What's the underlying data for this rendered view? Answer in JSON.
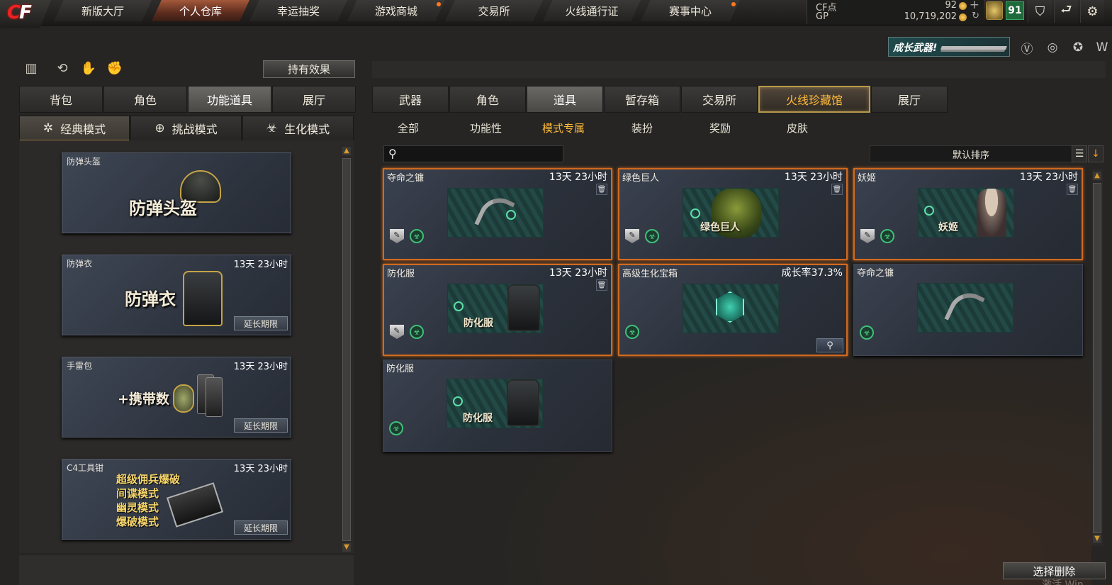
{
  "topnav": {
    "tabs": [
      "新版大厅",
      "个人仓库",
      "幸运抽奖",
      "游戏商城",
      "交易所",
      "火线通行证",
      "赛事中心"
    ],
    "active": "个人仓库"
  },
  "currency": {
    "cf_label": "CF点",
    "cf_value": "92",
    "gp_label": "GP",
    "gp_value": "10,719,202",
    "add_symbol": "+",
    "level": "91"
  },
  "growth_banner": "成长武器!",
  "hold_effect_button": "持有效果",
  "left_tabs": [
    "背包",
    "角色",
    "功能道具",
    "展厅"
  ],
  "left_active_tab": "功能道具",
  "mode_tabs": [
    {
      "label": "经典模式",
      "icon": "star-icon"
    },
    {
      "label": "挑战模式",
      "icon": "target-icon"
    },
    {
      "label": "生化模式",
      "icon": "biohazard-icon"
    }
  ],
  "left_items": [
    {
      "name": "防弹头盔",
      "time": "",
      "art_text": "防弹头盔",
      "extend": ""
    },
    {
      "name": "防弹衣",
      "time": "13天 23小时",
      "art_text": "防弹衣",
      "extend": "延长期限"
    },
    {
      "name": "手雷包",
      "time": "13天 23小时",
      "art_text": "+携带数",
      "extend": "延长期限"
    },
    {
      "name": "C4工具钳",
      "time": "13天 23小时",
      "art_lines": [
        "超级佣兵爆破",
        "间谍模式",
        "幽灵模式",
        "爆破模式"
      ],
      "extend": "延长期限"
    }
  ],
  "right_tabs": [
    "武器",
    "角色",
    "道具",
    "暂存箱",
    "交易所",
    "火线珍藏馆",
    "展厅"
  ],
  "right_active_tab": "道具",
  "right_featured_tab": "火线珍藏馆",
  "subtabs": [
    "全部",
    "功能性",
    "模式专属",
    "装扮",
    "奖励",
    "皮肤"
  ],
  "subtab_active": "模式专属",
  "search": {
    "placeholder": ""
  },
  "sort": {
    "label": "默认排序"
  },
  "items": [
    {
      "name": "夺命之镰",
      "time": "13天 23小时",
      "art": "",
      "selected": true
    },
    {
      "name": "绿色巨人",
      "time": "13天 23小时",
      "art": "绿色巨人",
      "selected": true
    },
    {
      "name": "妖姬",
      "time": "13天 23小时",
      "art": "妖姬",
      "selected": true
    },
    {
      "name": "防化服",
      "time": "13天 23小时",
      "art": "防化服",
      "selected": true
    },
    {
      "name": "高级生化宝箱",
      "time": "成长率37.3%",
      "art": "",
      "selected": true
    },
    {
      "name": "夺命之镰",
      "time": "",
      "art": "",
      "selected": false
    },
    {
      "name": "防化服",
      "time": "",
      "art": "防化服",
      "selected": false
    }
  ],
  "delete_button": "选择删除",
  "watermark": "激活 Win"
}
